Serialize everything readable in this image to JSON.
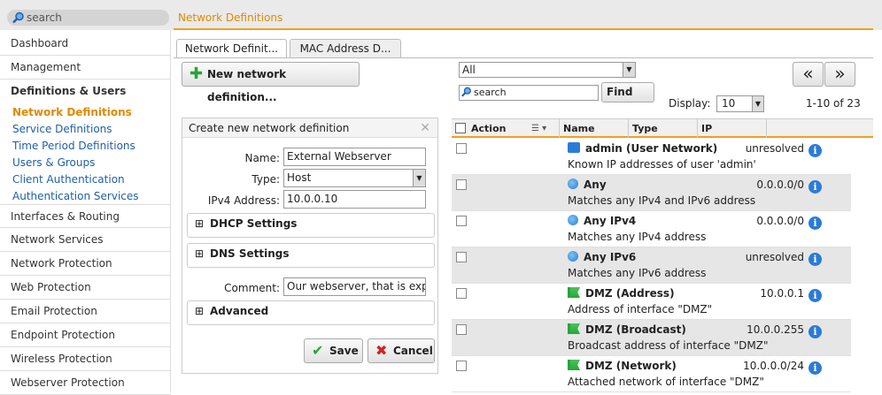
{
  "top": {
    "search_placeholder": "search",
    "page_title": "Network Definitions"
  },
  "sidebar": {
    "items": [
      "Dashboard",
      "Management",
      "Definitions & Users"
    ],
    "sub_items": [
      "Network Definitions",
      "Service Definitions",
      "Time Period Definitions",
      "Users & Groups",
      "Client Authentication",
      "Authentication Services"
    ],
    "more_items": [
      "Interfaces & Routing",
      "Network Services",
      "Network Protection",
      "Web Protection",
      "Email Protection",
      "Endpoint Protection",
      "Wireless Protection",
      "Webserver Protection"
    ]
  },
  "tabs": [
    "Network Definit...",
    "MAC Address D..."
  ],
  "toolbar": {
    "new_button": "New network definition...",
    "filter_value": "All",
    "search_placeholder": "search",
    "find_button": "Find",
    "display_label": "Display:",
    "display_value": "10",
    "range": "1-10 of 23",
    "prev": "«",
    "next": "»"
  },
  "form": {
    "title": "Create new network definition",
    "name_label": "Name:",
    "name_value": "External Webserver",
    "type_label": "Type:",
    "type_value": "Host",
    "ipv4_label": "IPv4 Address:",
    "ipv4_value": "10.0.0.10",
    "dhcp": "DHCP Settings",
    "dns": "DNS Settings",
    "comment_label": "Comment:",
    "comment_value": "Our webserver, that is exp",
    "advanced": "Advanced",
    "save": "Save",
    "cancel": "Cancel"
  },
  "grid": {
    "headers": [
      "Action",
      "Name",
      "Type",
      "IP"
    ],
    "rows": [
      {
        "name": "admin (User Network)",
        "desc": "Known IP addresses of user 'admin'",
        "value": "unresolved",
        "icon": "user-network-icon"
      },
      {
        "name": "Any",
        "desc": "Matches any IPv4 and IPv6 address",
        "value": "0.0.0.0/0",
        "icon": "globe-icon"
      },
      {
        "name": "Any IPv4",
        "desc": "Matches any IPv4 address",
        "value": "0.0.0.0/0",
        "icon": "globe-icon"
      },
      {
        "name": "Any IPv6",
        "desc": "Matches any IPv6 address",
        "value": "unresolved",
        "icon": "globe-icon"
      },
      {
        "name": "DMZ (Address)",
        "desc": "Address of interface \"DMZ\"",
        "value": "10.0.0.1",
        "icon": "interface-icon"
      },
      {
        "name": "DMZ (Broadcast)",
        "desc": "Broadcast address of interface \"DMZ\"",
        "value": "10.0.0.255",
        "icon": "interface-icon"
      },
      {
        "name": "DMZ (Network)",
        "desc": "Attached network of interface \"DMZ\"",
        "value": "10.0.0.0/24",
        "icon": "interface-icon"
      }
    ]
  },
  "colors": {
    "accent": "#e08a00",
    "link": "#1f5fa8",
    "info": "#2b7bd6"
  }
}
